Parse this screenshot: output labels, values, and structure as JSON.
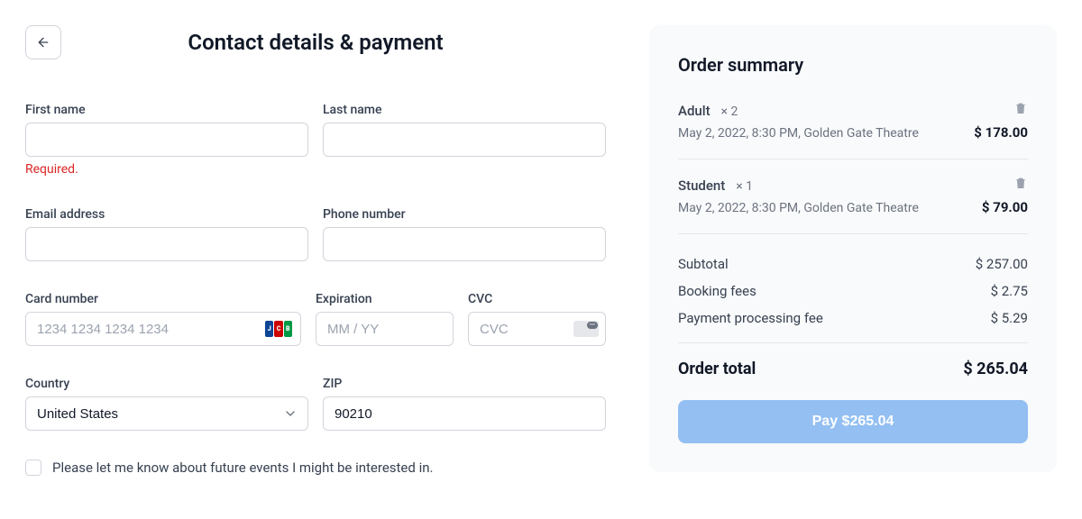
{
  "header": {
    "title": "Contact details & payment"
  },
  "form": {
    "first_name": {
      "label": "First name",
      "value": "",
      "error": "Required."
    },
    "last_name": {
      "label": "Last name",
      "value": ""
    },
    "email": {
      "label": "Email address",
      "value": ""
    },
    "phone": {
      "label": "Phone number",
      "value": ""
    },
    "card_number": {
      "label": "Card number",
      "placeholder": "1234 1234 1234 1234"
    },
    "expiration": {
      "label": "Expiration",
      "placeholder": "MM / YY"
    },
    "cvc": {
      "label": "CVC",
      "placeholder": "CVC"
    },
    "country": {
      "label": "Country",
      "value": "United States"
    },
    "zip": {
      "label": "ZIP",
      "value": "90210"
    },
    "marketing_checkbox": {
      "label": "Please let me know about future events I might be interested in.",
      "checked": false
    }
  },
  "summary": {
    "title": "Order summary",
    "items": [
      {
        "name": "Adult",
        "qty": "× 2",
        "meta": "May 2, 2022, 8:30 PM, Golden Gate Theatre",
        "price": "$ 178.00"
      },
      {
        "name": "Student",
        "qty": "× 1",
        "meta": "May 2, 2022, 8:30 PM, Golden Gate Theatre",
        "price": "$ 79.00"
      }
    ],
    "fees": [
      {
        "label": "Subtotal",
        "value": "$ 257.00"
      },
      {
        "label": "Booking fees",
        "value": "$ 2.75"
      },
      {
        "label": "Payment processing fee",
        "value": "$ 5.29"
      }
    ],
    "total": {
      "label": "Order total",
      "value": "$ 265.04"
    },
    "pay_button": "Pay $265.04"
  }
}
